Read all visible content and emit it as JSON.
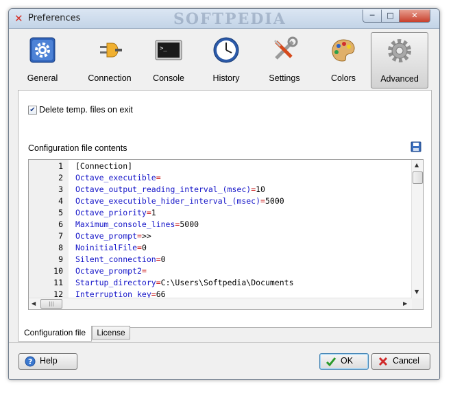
{
  "window": {
    "title": "Preferences",
    "watermark": "SOFTPEDIA",
    "controls": {
      "minimize": "─",
      "maximize": "□",
      "close": "✕"
    }
  },
  "toolbar": {
    "items": [
      {
        "label": "General",
        "icon": "gear-icon"
      },
      {
        "label": "Connection",
        "icon": "plug-icon"
      },
      {
        "label": "Console",
        "icon": "console-icon"
      },
      {
        "label": "History",
        "icon": "clock-icon"
      },
      {
        "label": "Settings",
        "icon": "tools-icon"
      },
      {
        "label": "Colors",
        "icon": "palette-icon"
      },
      {
        "label": "Advanced",
        "icon": "gear-grey-icon"
      }
    ],
    "active": "Advanced"
  },
  "options": {
    "delete_temp_label": "Delete temp. files on exit",
    "delete_temp_checked": true,
    "checkmark": "✔"
  },
  "config": {
    "section_label": "Configuration file contents",
    "lines": [
      {
        "n": "1",
        "key": "[Connection]",
        "eq": "",
        "val": ""
      },
      {
        "n": "2",
        "key": "Octave_executible",
        "eq": "=",
        "val": ""
      },
      {
        "n": "3",
        "key": "Octave_output_reading_interval_(msec)",
        "eq": "=",
        "val": "10"
      },
      {
        "n": "4",
        "key": "Octave_executible_hider_interval_(msec)",
        "eq": "=",
        "val": "5000"
      },
      {
        "n": "5",
        "key": "Octave_priority",
        "eq": "=",
        "val": "1"
      },
      {
        "n": "6",
        "key": "Maximum_console_lines",
        "eq": "=",
        "val": "5000"
      },
      {
        "n": "7",
        "key": "Octave_prompt",
        "eq": "=",
        "val": ">>"
      },
      {
        "n": "8",
        "key": "NoinitialFile",
        "eq": "=",
        "val": "0"
      },
      {
        "n": "9",
        "key": "Silent_connection",
        "eq": "=",
        "val": "0"
      },
      {
        "n": "10",
        "key": "Octave_prompt2",
        "eq": "=",
        "val": ""
      },
      {
        "n": "11",
        "key": "Startup_directory",
        "eq": "=",
        "val": "C:\\Users\\Softpedia\\Documents"
      },
      {
        "n": "12",
        "key": "Interruption_key",
        "eq": "=",
        "val": "66"
      }
    ]
  },
  "tabs": [
    {
      "label": "Configuration file"
    },
    {
      "label": "License"
    }
  ],
  "buttons": {
    "help": "Help",
    "ok": "OK",
    "cancel": "Cancel"
  }
}
